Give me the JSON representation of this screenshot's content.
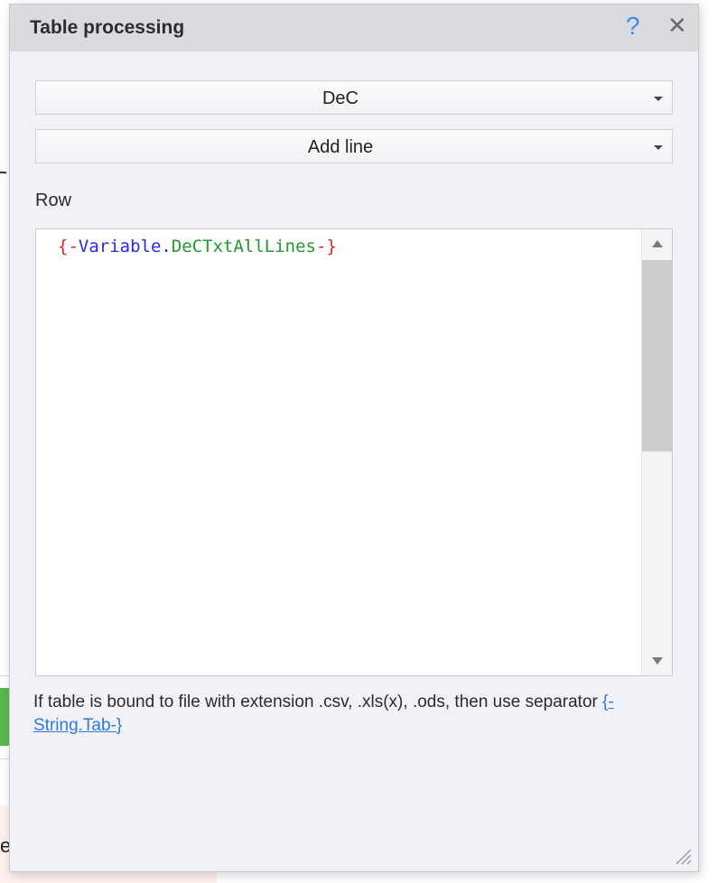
{
  "dialog": {
    "title": "Table processing",
    "help_icon": "?",
    "close_icon": "✕"
  },
  "table_select": {
    "value": "DeC"
  },
  "action_select": {
    "value": "Add line"
  },
  "row": {
    "label": "Row",
    "editor": {
      "open_brace": "{-",
      "variable_prefix": "Variable.",
      "variable_name": "DeCTxtAllLines",
      "close_brace": "-}"
    }
  },
  "hint": {
    "text": "If table is bound to file with extension .csv, .xls(x), .ods, then  use separator ",
    "link": "{-String.Tab-}"
  },
  "icons": {
    "help": "question-mark-icon",
    "close": "close-icon",
    "dropdown_arrow": "chevron-down-icon",
    "scroll_up": "scroll-up-arrow-icon",
    "scroll_down": "scroll-down-arrow-icon",
    "resize": "resize-grip-icon"
  },
  "colors": {
    "accent": "#3b8ee0",
    "link": "#2f7ad8",
    "brace": "#e0222d",
    "variable": "#2a2ae0",
    "name": "#1f9a2d"
  }
}
